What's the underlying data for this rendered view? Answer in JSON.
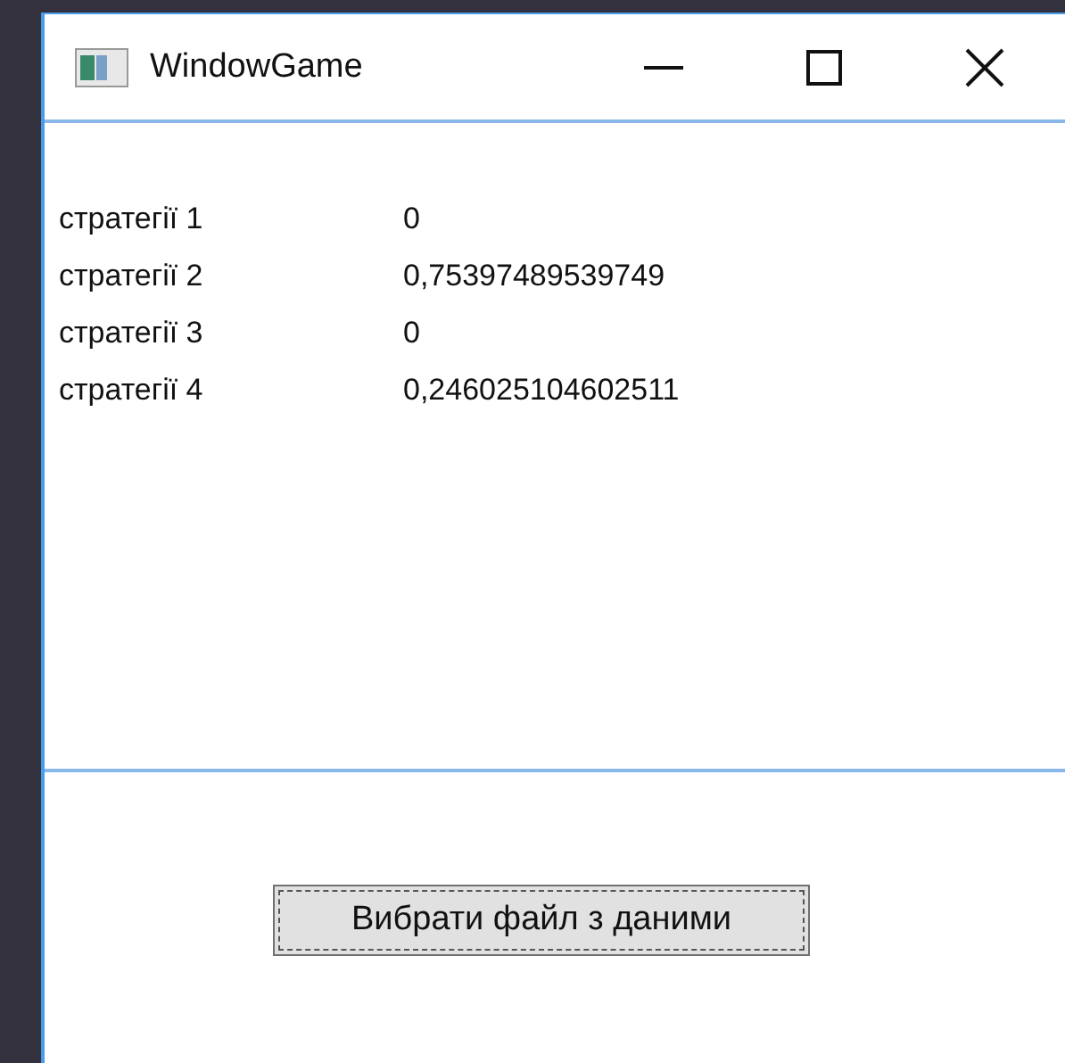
{
  "window": {
    "title": "WindowGame"
  },
  "results": [
    {
      "label": "стратегії 1",
      "value": "0"
    },
    {
      "label": "стратегії 2",
      "value": "0,75397489539749"
    },
    {
      "label": "стратегії 3",
      "value": "0"
    },
    {
      "label": "стратегії 4",
      "value": "0,246025104602511"
    }
  ],
  "button": {
    "label": "Вибрати файл з даними",
    "focused": true
  }
}
